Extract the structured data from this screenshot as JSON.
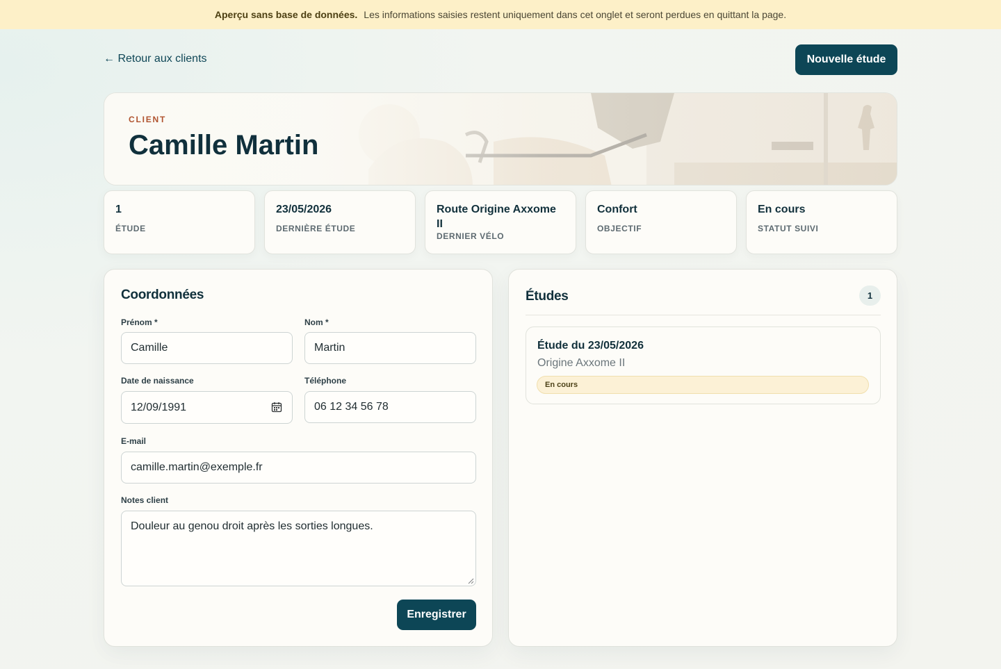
{
  "banner": {
    "title": "Aperçu sans base de données.",
    "message": "Les informations saisies restent uniquement dans cet onglet et seront perdues en quittant la page."
  },
  "nav": {
    "back_label": "← Retour aux clients",
    "new_study_label": "Nouvelle étude"
  },
  "client": {
    "section_label": "CLIENT",
    "name": "Camille Martin"
  },
  "stats": [
    {
      "value": "1",
      "label": "Étude"
    },
    {
      "value": "23/05/2026",
      "label": "Dernière étude"
    },
    {
      "value": "Route Origine Axxome II",
      "label": "Dernier vélo"
    },
    {
      "value": "Confort",
      "label": "Objectif"
    },
    {
      "value": "En cours",
      "label": "Statut suivi"
    }
  ],
  "contact": {
    "title": "Coordonnées",
    "first_name": {
      "label": "Prénom *",
      "value": "Camille"
    },
    "last_name": {
      "label": "Nom *",
      "value": "Martin"
    },
    "birth_date": {
      "label": "Date de naissance",
      "value": "12/09/1991"
    },
    "phone": {
      "label": "Téléphone",
      "value": "06 12 34 56 78"
    },
    "email": {
      "label": "E-mail",
      "value": "camille.martin@exemple.fr"
    },
    "notes": {
      "label": "Notes client",
      "value": "Douleur au genou droit après les sorties longues."
    },
    "save_label": "Enregistrer"
  },
  "studies": {
    "title": "Études",
    "count": "1",
    "items": [
      {
        "title": "Étude du 23/05/2026",
        "bike": "Origine Axxome II",
        "status": "En cours"
      }
    ]
  },
  "colors": {
    "primary": "#0d4656",
    "banner_bg": "#fdf0c8",
    "accent_label": "#b0532f",
    "status_pill_bg": "#fcf1d6"
  },
  "icons": {
    "calendar": "calendar-icon"
  }
}
